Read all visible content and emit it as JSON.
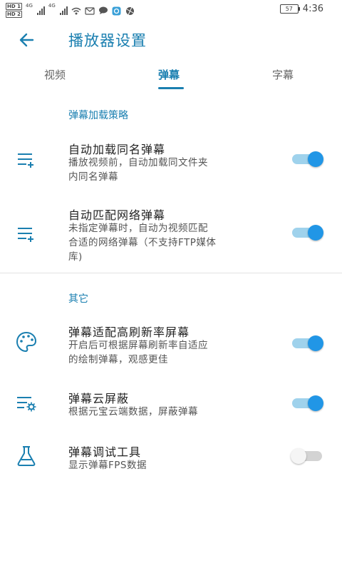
{
  "status": {
    "net1": "4G",
    "net2": "4G",
    "battery": "57",
    "time": "4:36"
  },
  "header": {
    "title": "播放器设置"
  },
  "tabs": [
    {
      "label": "视频",
      "active": false
    },
    {
      "label": "弹幕",
      "active": true
    },
    {
      "label": "字幕",
      "active": false
    }
  ],
  "sections": [
    {
      "title": "弹幕加载策略"
    },
    {
      "title": "其它"
    }
  ],
  "items": [
    {
      "title": "自动加载同名弹幕",
      "desc": [
        "播放视频前，自动加载同文件夹",
        "内同名弹幕"
      ],
      "enabled": true,
      "icon": "playlist-add-icon"
    },
    {
      "title": "自动匹配网络弹幕",
      "desc": [
        "未指定弹幕时，自动为视频匹配",
        "合适的网络弹幕（不支持FTP媒体",
        "库)"
      ],
      "enabled": true,
      "icon": "playlist-add-icon"
    },
    {
      "title": "弹幕适配高刷新率屏幕",
      "desc": [
        "开启后可根据屏幕刷新率自适应",
        "的绘制弹幕，观感更佳"
      ],
      "enabled": true,
      "icon": "palette-icon"
    },
    {
      "title": "弹幕云屏蔽",
      "desc": [
        "根据元宝云端数据，屏蔽弹幕"
      ],
      "enabled": true,
      "icon": "list-settings-icon"
    },
    {
      "title": "弹幕调试工具",
      "desc": [
        "显示弹幕FPS数据"
      ],
      "enabled": false,
      "icon": "flask-icon"
    }
  ],
  "colors": {
    "accent": "#1a7fb0",
    "switch_on": "#2196e6",
    "switch_track_on": "#9fd2ec",
    "switch_off": "#d3d3d3"
  }
}
